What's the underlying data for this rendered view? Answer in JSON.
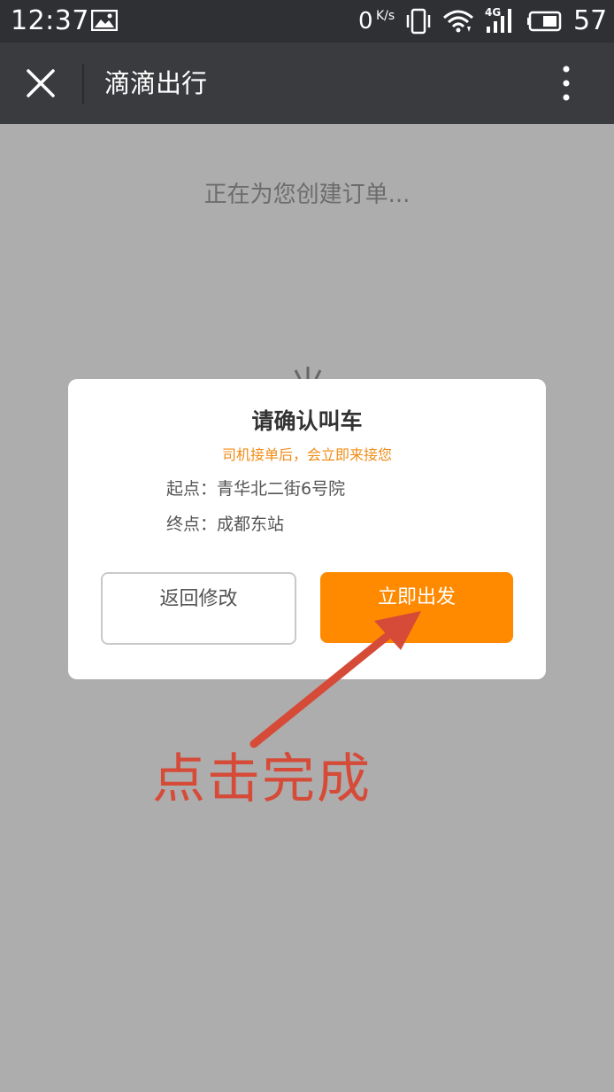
{
  "status_bar": {
    "time": "12:37",
    "net_speed": "0",
    "net_unit": "K/s",
    "signal_label": "4G",
    "battery_level": "57",
    "icons": [
      "image-icon",
      "vibrate-icon",
      "wifi-icon",
      "signal-icon",
      "battery-icon"
    ]
  },
  "nav_bar": {
    "title": "滴滴出行",
    "icons": [
      "close-icon",
      "more-icon"
    ]
  },
  "background": {
    "status_text": "正在为您创建订单..."
  },
  "dialog": {
    "title": "请确认叫车",
    "subtitle": "司机接单后，会立即来接您",
    "start_label": "起点：",
    "start_value": "青华北二街6号院",
    "end_label": "终点：",
    "end_value": "成都东站",
    "back_button": "返回修改",
    "go_button": "立即出发"
  },
  "annotation": {
    "text": "点击完成"
  },
  "colors": {
    "status_bar_bg": "#2f3034",
    "nav_bar_bg": "#3a3b3f",
    "overlay_bg": "#adadad",
    "accent_orange": "#ff8a00",
    "subtitle_orange": "#f08c16",
    "annotation_red": "#d64a38"
  }
}
